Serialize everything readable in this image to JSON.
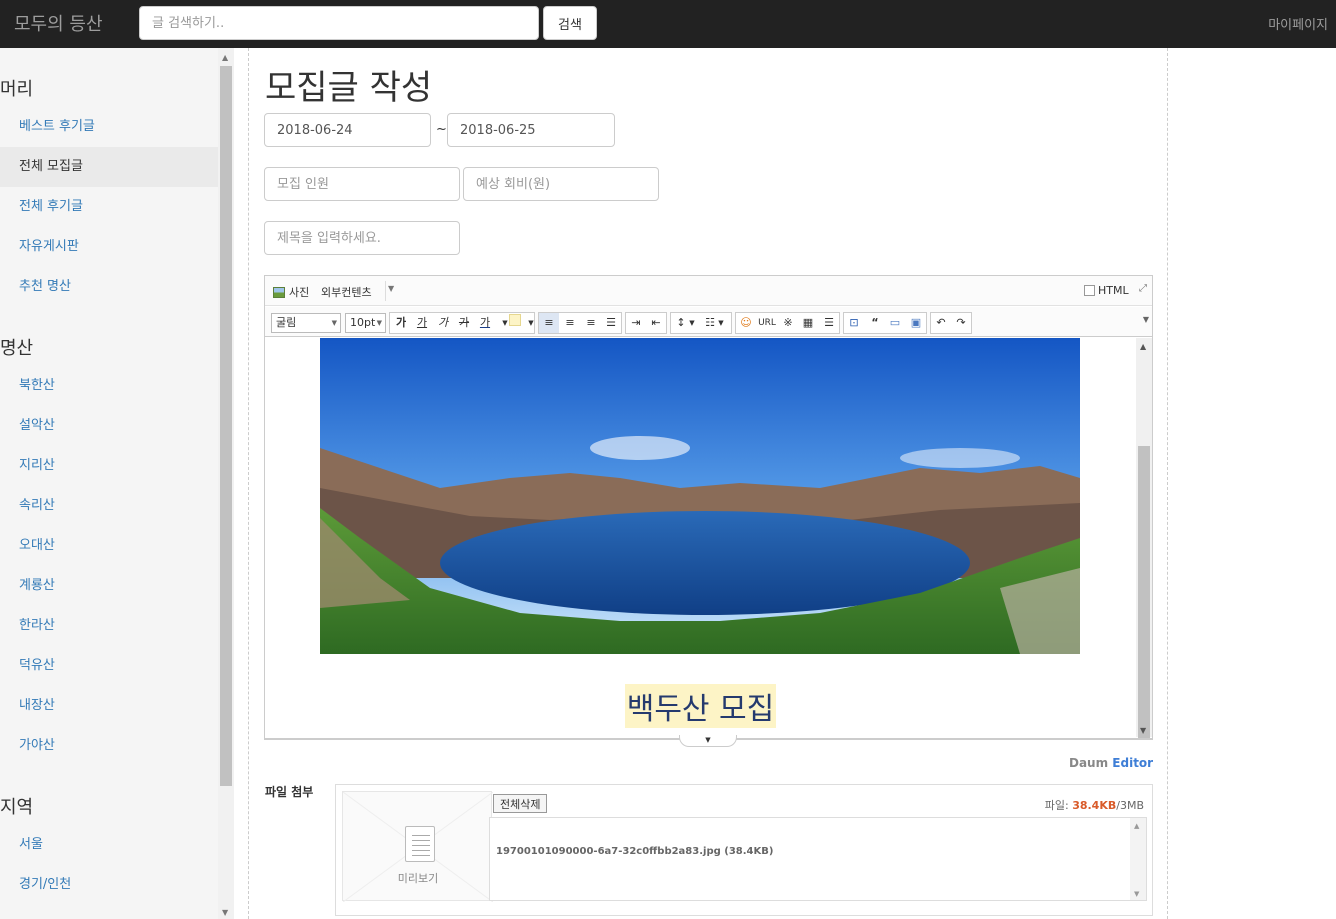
{
  "navbar": {
    "brand": "모두의 등산",
    "search_placeholder": "글 검색하기..",
    "search_button": "검색",
    "mypage": "마이페이지"
  },
  "sidebar": {
    "sections": [
      {
        "title": "머리",
        "items": [
          "베스트 후기글",
          "전체 모집글",
          "전체 후기글",
          "자유게시판",
          "추천 명산"
        ]
      },
      {
        "title": "명산",
        "items": [
          "북한산",
          "설악산",
          "지리산",
          "속리산",
          "오대산",
          "계룡산",
          "한라산",
          "덕유산",
          "내장산",
          "가야산"
        ]
      },
      {
        "title": "지역",
        "items": [
          "서울",
          "경기/인천"
        ]
      }
    ],
    "active_item": "전체 모집글"
  },
  "form": {
    "title": "모집글 작성",
    "date_from": "2018-06-24",
    "date_separator": "~",
    "date_to": "2018-06-25",
    "members_placeholder": "모집 인원",
    "fee_placeholder": "예상 회비(원)",
    "subject_placeholder": "제목을 입력하세요."
  },
  "editor": {
    "toolbar1": {
      "photo": "사진",
      "external": "외부컨텐츠",
      "html": "HTML"
    },
    "toolbar2": {
      "font": "굴림",
      "size": "10pt",
      "bold": "가",
      "underline": "가",
      "italic": "가",
      "strike": "가",
      "font_color": "가",
      "url": "URL",
      "special_char": "※",
      "quote": "“"
    },
    "content_caption": "백두산 모집",
    "brand_prefix": "Daum",
    "brand_suffix": "Editor"
  },
  "attachments": {
    "label": "파일 첨부",
    "preview_label": "미리보기",
    "delete_all": "전체삭제",
    "size_prefix": "파일:",
    "size_used": "38.4KB",
    "size_limit": "/3MB",
    "files": [
      "19700101090000-6a7-32c0ffbb2a83.jpg (38.4KB)"
    ]
  },
  "colors": {
    "navbar_bg": "#222222",
    "link": "#337ab7",
    "caption_bg": "#fdf4c6",
    "caption_text": "#253a6e",
    "size_used": "#d95b2a",
    "editor_brand": "#3e7ed6"
  }
}
